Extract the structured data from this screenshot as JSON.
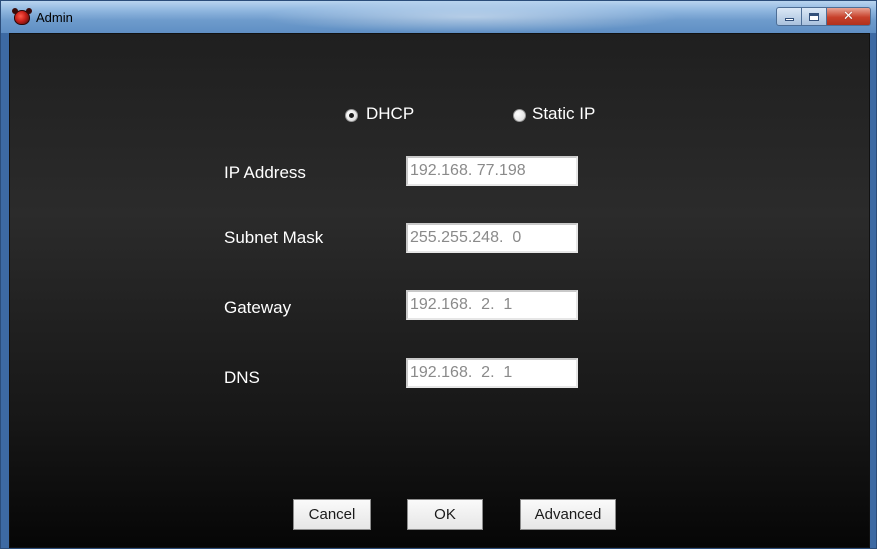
{
  "window": {
    "title": "Admin"
  },
  "network_mode": {
    "selected": "DHCP",
    "options": [
      {
        "label": "DHCP",
        "checked": true
      },
      {
        "label": "Static IP",
        "checked": false
      }
    ]
  },
  "fields": {
    "ip_address": {
      "label": "IP Address",
      "value": "192.168. 77.198"
    },
    "subnet_mask": {
      "label": "Subnet Mask",
      "value": "255.255.248.  0"
    },
    "gateway": {
      "label": "Gateway",
      "value": "192.168.  2.  1"
    },
    "dns": {
      "label": "DNS",
      "value": "192.168.  2.  1"
    }
  },
  "buttons": {
    "cancel": "Cancel",
    "ok": "OK",
    "advanced": "Advanced"
  },
  "icons": {
    "app": "app-icon",
    "minimize": "minimize-icon",
    "maximize": "maximize-icon",
    "close": "close-icon"
  }
}
